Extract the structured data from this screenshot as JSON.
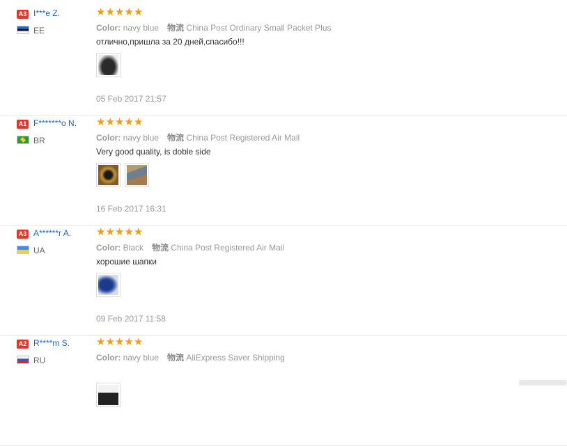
{
  "reviews": [
    {
      "level": "A3",
      "user": "I***e Z.",
      "country": "EE",
      "flag": "flag-ee",
      "stars": 5,
      "color_label": "Color:",
      "color_value": "navy blue",
      "shipping_label": "物流",
      "shipping_value": "China Post Ordinary Small Packet Plus",
      "feedback": "отлично,пришла за 20 дней,спасибо!!!",
      "images": [
        "hat-dark"
      ],
      "date": "05 Feb 2017 21:57"
    },
    {
      "level": "A1",
      "user": "F*******o N.",
      "country": "BR",
      "flag": "flag-br",
      "stars": 5,
      "color_label": "Color:",
      "color_value": "navy blue",
      "shipping_label": "物流",
      "shipping_value": "China Post Registered Air Mail",
      "feedback": "Very good quality, is doble side",
      "images": [
        "hat-fur",
        "hat-gray"
      ],
      "date": "16 Feb 2017 16:31"
    },
    {
      "level": "A3",
      "user": "A******r A.",
      "country": "UA",
      "flag": "flag-ua",
      "stars": 5,
      "color_label": "Color:",
      "color_value": "Black",
      "shipping_label": "物流",
      "shipping_value": "China Post Registered Air Mail",
      "feedback": "хорошие шапки",
      "images": [
        "hat-navy"
      ],
      "date": "09 Feb 2017 11:58"
    },
    {
      "level": "A2",
      "user": "R****m S.",
      "country": "RU",
      "flag": "flag-ru",
      "stars": 5,
      "color_label": "Color:",
      "color_value": "navy blue",
      "shipping_label": "物流",
      "shipping_value": "AliExpress Saver Shipping",
      "feedback": "",
      "images": [
        "hat-black"
      ],
      "date": ""
    }
  ],
  "colors": {
    "badge": "#e0362c",
    "username": "#1a66c2",
    "star": "#f39c12",
    "meta": "#999999"
  }
}
